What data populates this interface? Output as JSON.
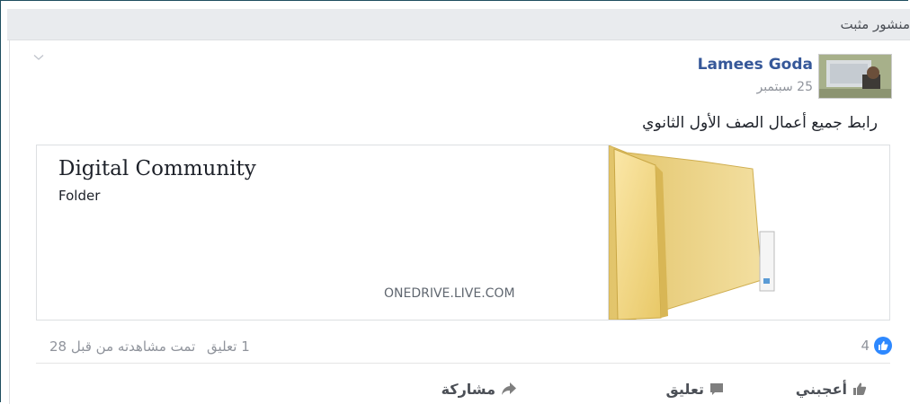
{
  "header": {
    "title": "منشور مثبت"
  },
  "post": {
    "author": "Lamees Goda",
    "date": "25 سبتمبر",
    "text": "رابط جميع أعمال الصف الأول الثانوي",
    "link": {
      "title": "Digital Community",
      "subtitle": "Folder",
      "domain": "ONEDRIVE.LIVE.COM"
    },
    "stats": {
      "comments": "1 تعليق",
      "seen": "تمت مشاهدته من قبل 28",
      "likes": "4"
    },
    "actions": {
      "like": "أعجبني",
      "comment": "تعليق",
      "share": "مشاركة"
    }
  },
  "icons": {
    "options": "chevron-down-icon",
    "like_reaction": "like-icon",
    "like": "thumbs-up-icon",
    "comment": "comment-icon",
    "share": "share-arrow-icon",
    "folder": "folder-icon"
  },
  "colors": {
    "accent": "#365899",
    "like_reaction": "#2d88ff",
    "header_bg": "#e9ebee",
    "muted_text": "#90949c",
    "action_text": "#4b4f56"
  }
}
